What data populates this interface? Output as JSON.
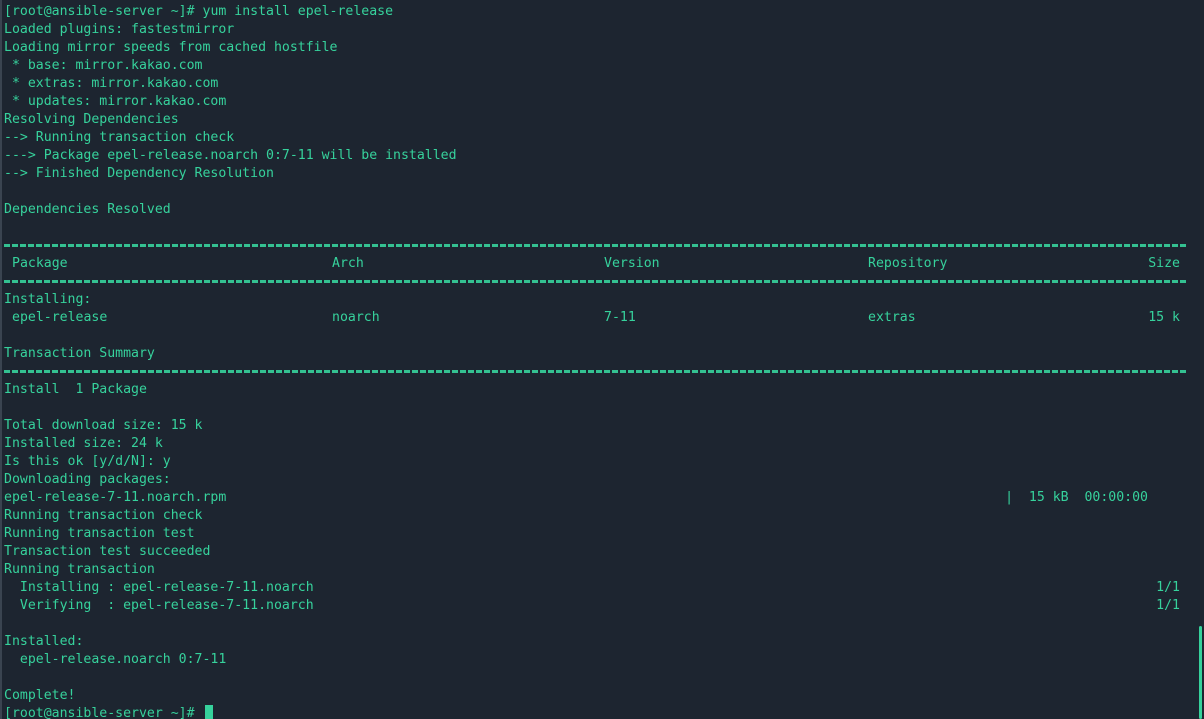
{
  "terminal": {
    "prompt": "[root@ansible-server ~]# ",
    "command": "yum install epel-release",
    "lines_before_table": [
      "Loaded plugins: fastestmirror",
      "Loading mirror speeds from cached hostfile",
      " * base: mirror.kakao.com",
      " * extras: mirror.kakao.com",
      " * updates: mirror.kakao.com",
      "Resolving Dependencies",
      "--> Running transaction check",
      "---> Package epel-release.noarch 0:7-11 will be installed",
      "--> Finished Dependency Resolution",
      "",
      "Dependencies Resolved",
      ""
    ],
    "table": {
      "headers": [
        "Package",
        "Arch",
        "Version",
        "Repository",
        "Size"
      ],
      "section_label": "Installing:",
      "rows": [
        [
          "epel-release",
          "noarch",
          "7-11",
          "extras",
          "15 k"
        ]
      ]
    },
    "summary_title": "Transaction Summary",
    "summary_install": "Install  1 Package",
    "lines_after_summary": [
      "",
      "Total download size: 15 k",
      "Installed size: 24 k",
      "Is this ok [y/d/N]: y",
      "Downloading packages:"
    ],
    "download": {
      "file": "epel-release-7-11.noarch.rpm",
      "stats": "|  15 kB  00:00:00"
    },
    "transaction_lines": [
      "Running transaction check",
      "Running transaction test",
      "Transaction test succeeded",
      "Running transaction"
    ],
    "progress": [
      {
        "label": "  Installing : epel-release-7-11.noarch",
        "count": "1/1"
      },
      {
        "label": "  Verifying  : epel-release-7-11.noarch",
        "count": "1/1"
      }
    ],
    "installed_title": "Installed:",
    "installed_item": "  epel-release.noarch 0:7-11",
    "complete": "Complete!",
    "final_prompt": "[root@ansible-server ~]# "
  },
  "colors": {
    "background": "#1d2530",
    "foreground": "#36d29c"
  }
}
